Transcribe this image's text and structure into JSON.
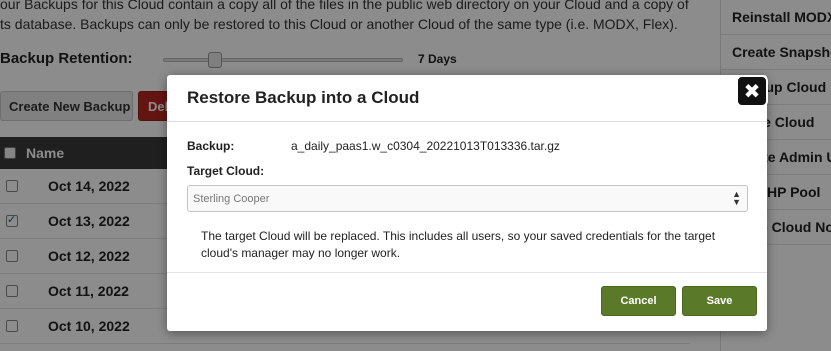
{
  "intro": {
    "line1": "our Backups for this Cloud contain a copy all of the files in the public web directory on your Cloud and a copy of",
    "line2": "ts database. Backups can only be restored to this Cloud or another Cloud of the same type (i.e. MODX, Flex)."
  },
  "retention": {
    "label": "Backup Retention:",
    "value_text": "7 Days"
  },
  "actions": {
    "create_label": "Create New Backup",
    "delete_label": "Delete"
  },
  "table": {
    "header_name": "Name",
    "rows": [
      {
        "date": "Oct 14, 2022",
        "checked": false
      },
      {
        "date": "Oct 13, 2022",
        "checked": true
      },
      {
        "date": "Oct 12, 2022",
        "checked": false
      },
      {
        "date": "Oct 11, 2022",
        "checked": false
      },
      {
        "date": "Oct 10, 2022",
        "checked": false
      }
    ]
  },
  "sidebar": {
    "items": [
      {
        "label": "Reinstall MODX"
      },
      {
        "label": "Create Snapshot"
      },
      {
        "label": "Backup Cloud"
      },
      {
        "label": "Clone Cloud"
      },
      {
        "label": "Create Admin User"
      },
      {
        "label": "Set PHP Pool"
      },
      {
        "label": "Move Cloud Now"
      }
    ]
  },
  "modal": {
    "title": "Restore Backup into a Cloud",
    "close_symbol": "✖",
    "backup_label": "Backup:",
    "backup_value": "a_daily_paas1.w_c0304_20221013T013336.tar.gz",
    "target_label": "Target Cloud:",
    "target_value": "Sterling Cooper",
    "warning": "The target Cloud will be replaced. This includes all users, so your saved credentials for the target cloud's manager may no longer work.",
    "cancel_label": "Cancel",
    "save_label": "Save"
  },
  "colors": {
    "primary_button": "#5a7a2a",
    "delete_button": "#b8271f",
    "table_header": "#3a3a3a"
  }
}
